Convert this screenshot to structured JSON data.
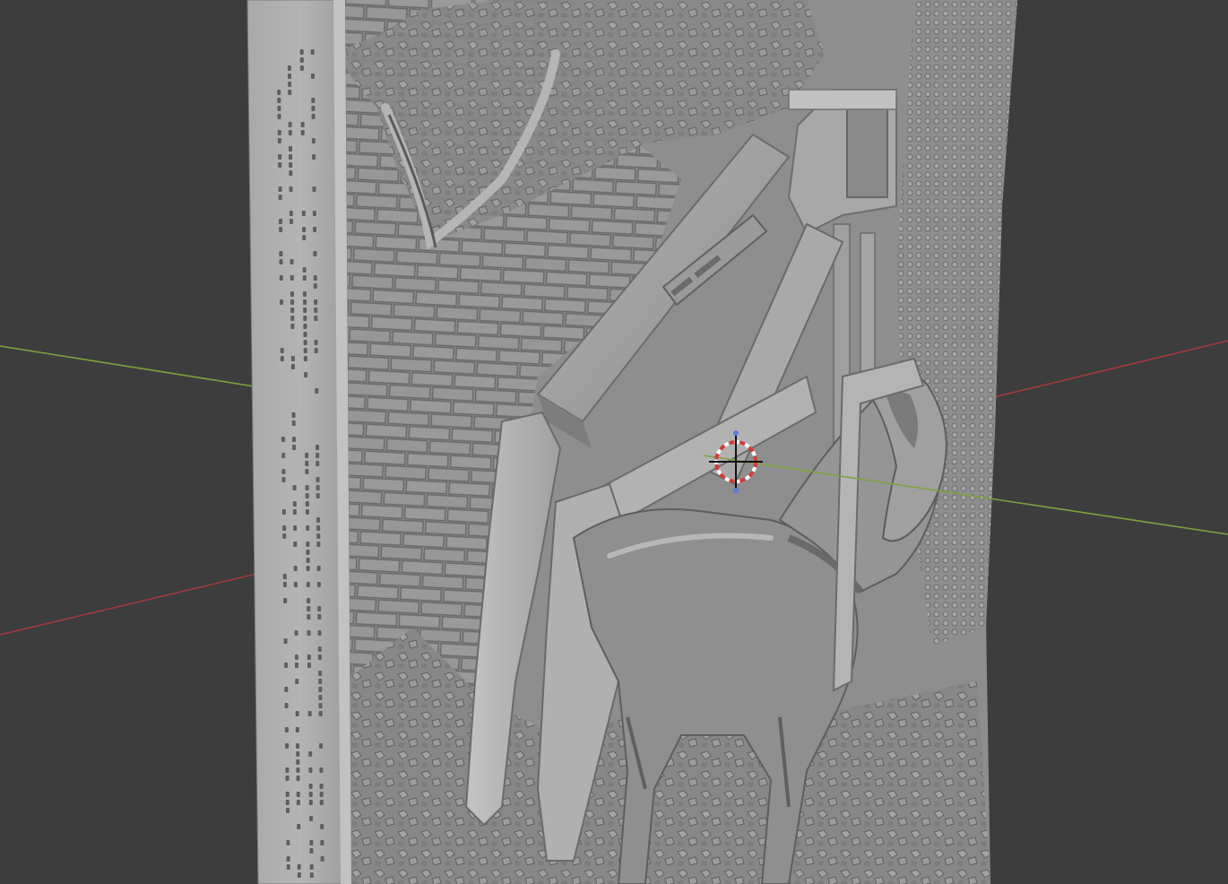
{
  "viewport": {
    "background_color": "#3d3d3d",
    "x_axis_color": "#a13a3f",
    "y_axis_color": "#7ea33c",
    "mesh_base_color": "#9b9b9b",
    "mesh_dark_color": "#5e5e5e",
    "mesh_light_color": "#c6c6c6",
    "cursor_ring_colors": [
      "#d23a3a",
      "#ffffff"
    ],
    "cursor_icon": "3d-cursor-icon"
  }
}
